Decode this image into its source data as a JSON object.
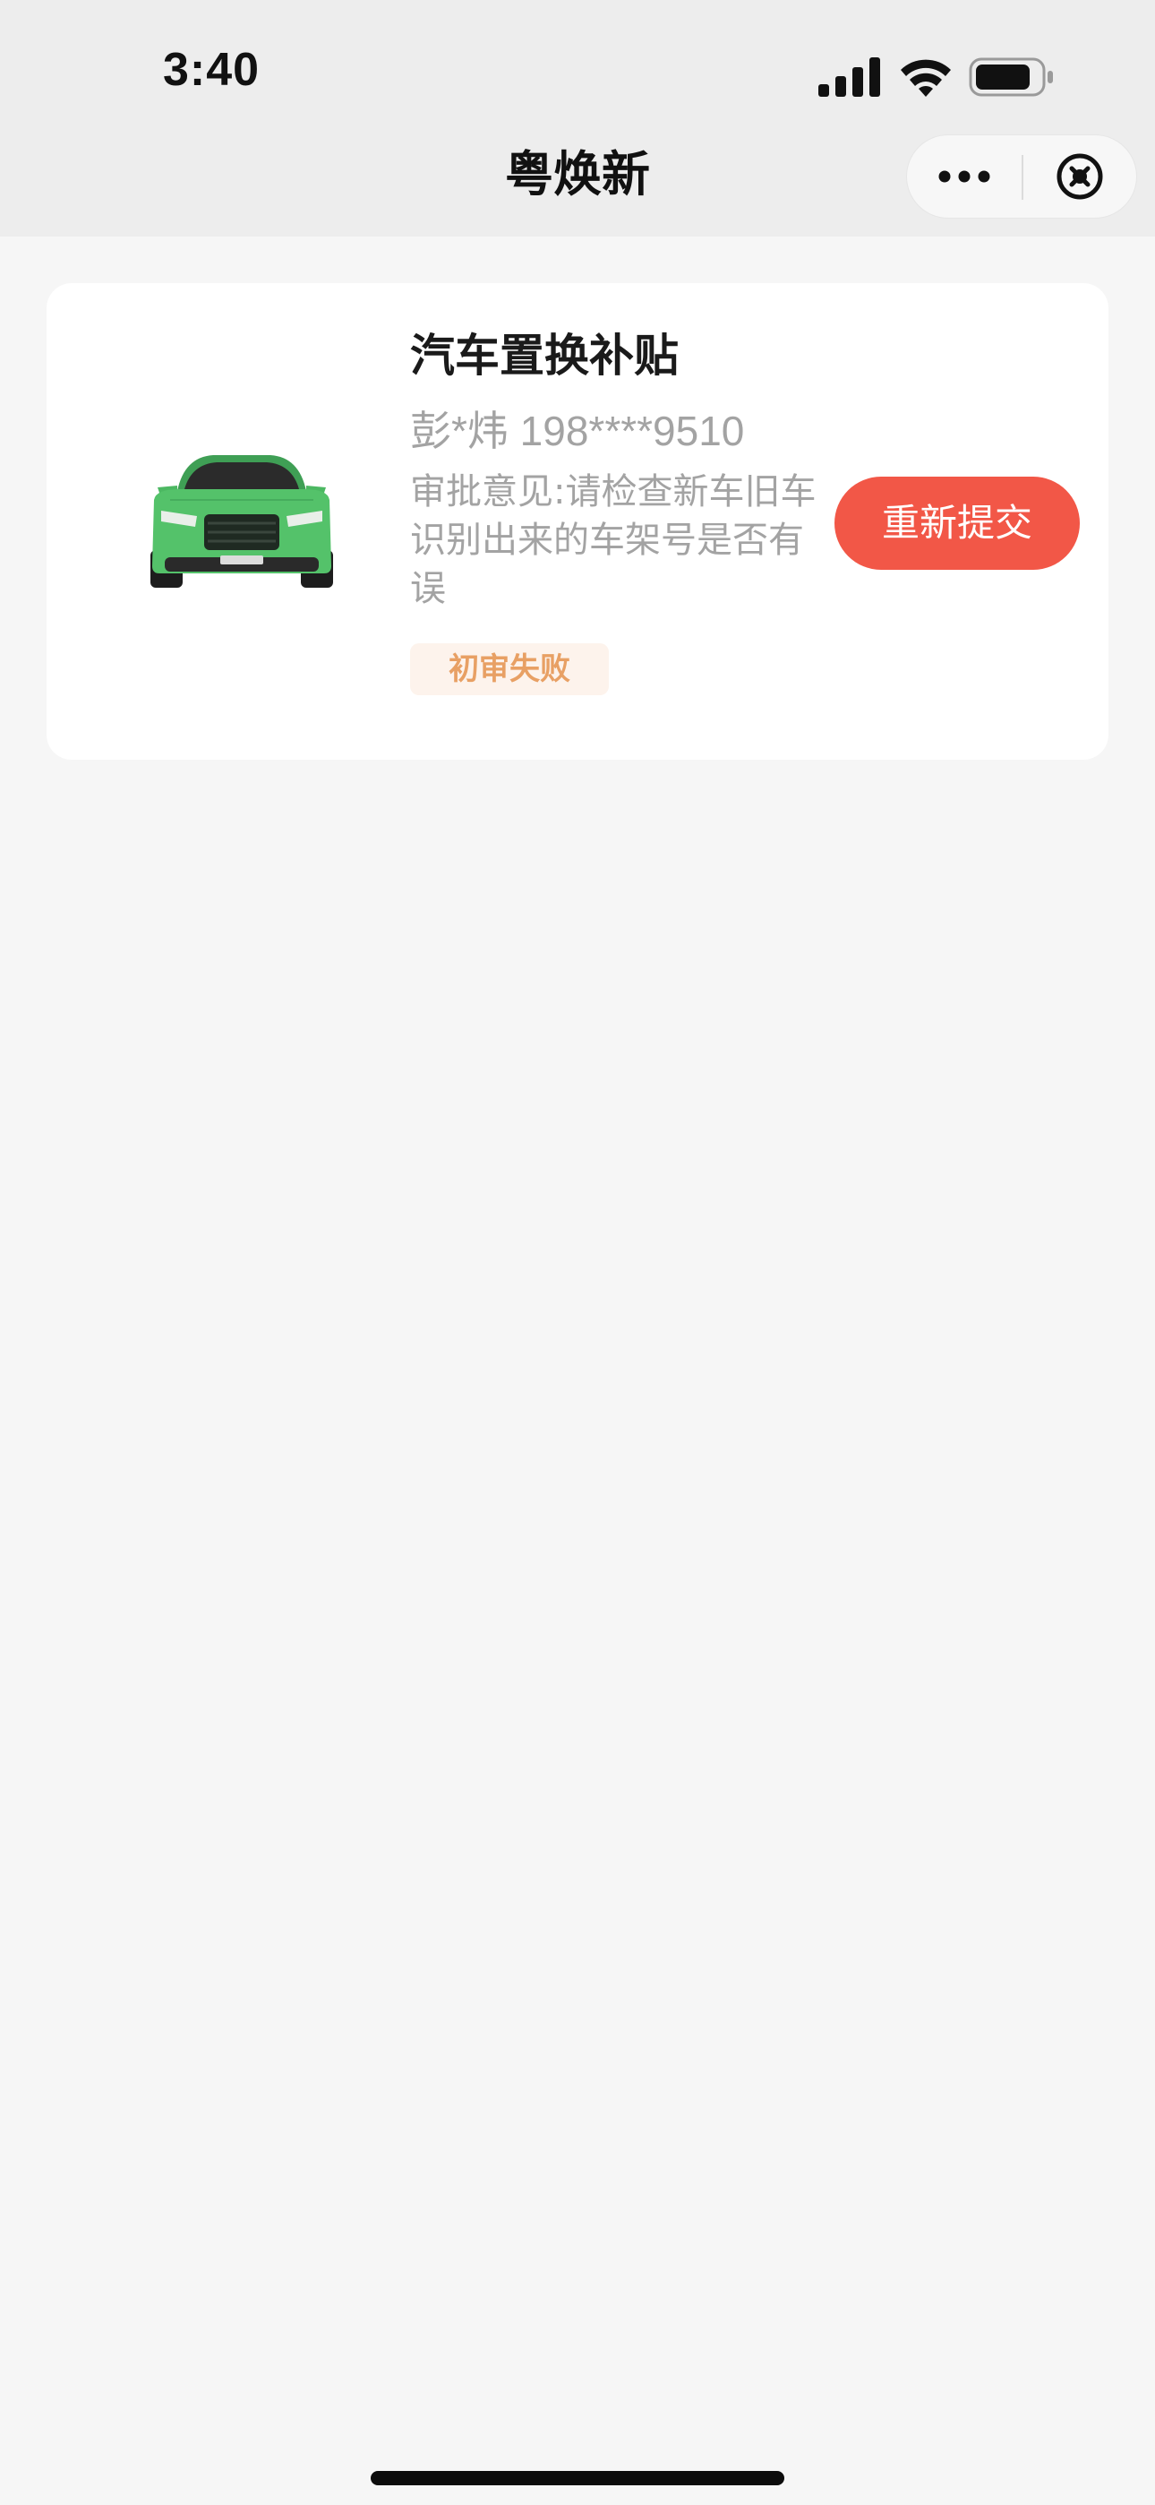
{
  "status_bar": {
    "time": "3:40"
  },
  "nav": {
    "title": "粤焕新",
    "more_icon": "more-dots-icon",
    "close_icon": "close-circle-icon"
  },
  "application": {
    "title": "汽车置换补贴",
    "applicant": "彭*炜 198****9510",
    "opinion": "审批意见:请检查新车旧车识别出来的车架号是否有误",
    "status": "初审失败",
    "action_label": "重新提交",
    "image": "green-suv-car-image"
  },
  "colors": {
    "action_button": "#f25747",
    "status_text": "#e8a064",
    "status_bg": "#fdf3ec",
    "car_body": "#54c26a"
  }
}
